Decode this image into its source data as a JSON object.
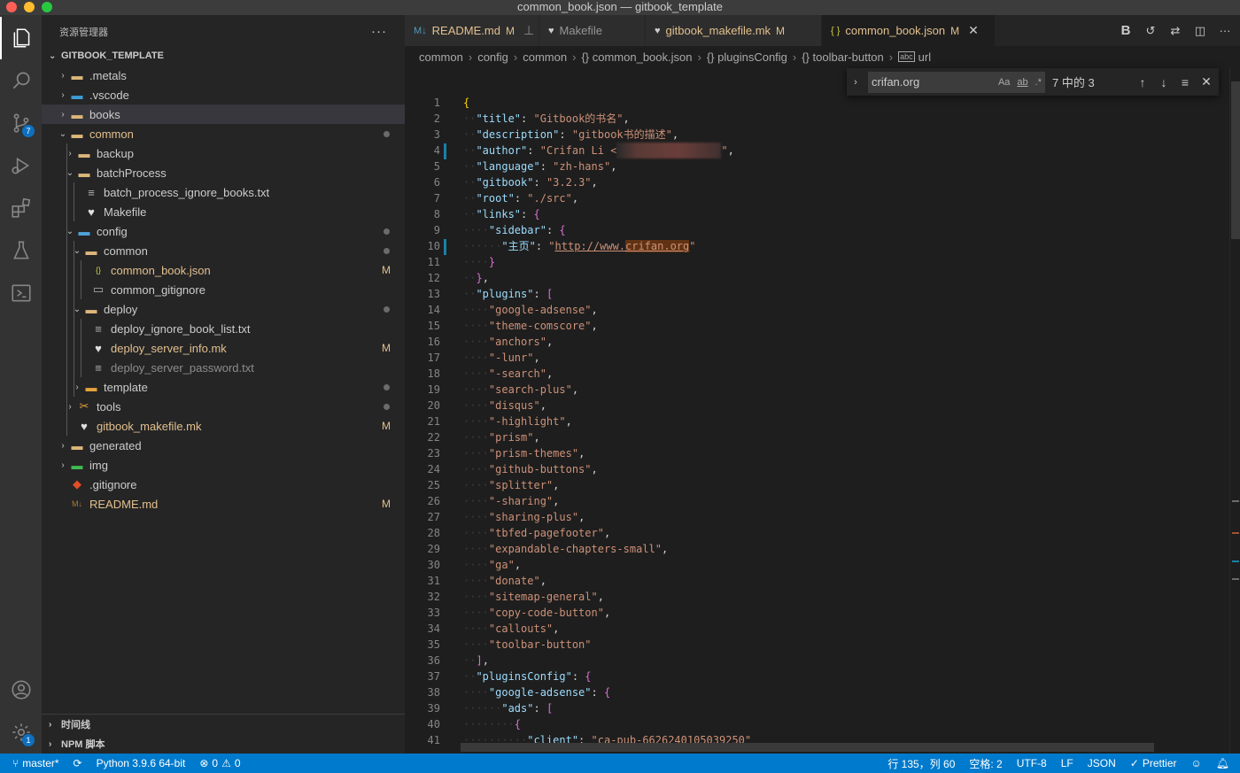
{
  "window": {
    "title": "common_book.json — gitbook_template"
  },
  "activity": {
    "scm_badge": "7",
    "settings_badge": "1"
  },
  "sidebar": {
    "title": "资源管理器",
    "more": "···",
    "root": "GITBOOK_TEMPLATE",
    "tree": [
      {
        "label": ".metals",
        "depth": 0,
        "twist": "›",
        "icon": "folder",
        "state": ""
      },
      {
        "label": ".vscode",
        "depth": 0,
        "twist": "›",
        "icon": "folder-vscode",
        "state": ""
      },
      {
        "label": "books",
        "depth": 0,
        "twist": "›",
        "icon": "folder",
        "state": "",
        "selected": true
      },
      {
        "label": "common",
        "depth": 0,
        "twist": "⌄",
        "icon": "folder-open",
        "state": "dot",
        "color": "mod"
      },
      {
        "label": "backup",
        "depth": 1,
        "twist": "›",
        "icon": "folder",
        "state": ""
      },
      {
        "label": "batchProcess",
        "depth": 1,
        "twist": "⌄",
        "icon": "folder-open",
        "state": ""
      },
      {
        "label": "batch_process_ignore_books.txt",
        "depth": 2,
        "twist": "",
        "icon": "file-text",
        "state": ""
      },
      {
        "label": "Makefile",
        "depth": 2,
        "twist": "",
        "icon": "makefile",
        "state": ""
      },
      {
        "label": "config",
        "depth": 1,
        "twist": "⌄",
        "icon": "folder-config",
        "state": "dot"
      },
      {
        "label": "common",
        "depth": 2,
        "twist": "⌄",
        "icon": "folder-open",
        "state": "dot"
      },
      {
        "label": "common_book.json",
        "depth": 3,
        "twist": "",
        "icon": "json",
        "state": "M",
        "color": "mod"
      },
      {
        "label": "common_gitignore",
        "depth": 3,
        "twist": "",
        "icon": "file",
        "state": ""
      },
      {
        "label": "deploy",
        "depth": 2,
        "twist": "⌄",
        "icon": "folder-open",
        "state": "dot"
      },
      {
        "label": "deploy_ignore_book_list.txt",
        "depth": 3,
        "twist": "",
        "icon": "file-text",
        "state": ""
      },
      {
        "label": "deploy_server_info.mk",
        "depth": 3,
        "twist": "",
        "icon": "makefile",
        "state": "M",
        "color": "mod"
      },
      {
        "label": "deploy_server_password.txt",
        "depth": 3,
        "twist": "",
        "icon": "file-text",
        "state": "",
        "color": "dim"
      },
      {
        "label": "template",
        "depth": 2,
        "twist": "›",
        "icon": "folder-template",
        "state": "dot"
      },
      {
        "label": "tools",
        "depth": 1,
        "twist": "›",
        "icon": "folder-tools",
        "state": "dot"
      },
      {
        "label": "gitbook_makefile.mk",
        "depth": 1,
        "twist": "",
        "icon": "makefile",
        "state": "M",
        "color": "mod"
      },
      {
        "label": "generated",
        "depth": 0,
        "twist": "›",
        "icon": "folder",
        "state": ""
      },
      {
        "label": "img",
        "depth": 0,
        "twist": "›",
        "icon": "folder-img",
        "state": ""
      },
      {
        "label": ".gitignore",
        "depth": 0,
        "twist": "",
        "icon": "git",
        "state": ""
      },
      {
        "label": "README.md",
        "depth": 0,
        "twist": "",
        "icon": "markdown",
        "state": "M",
        "color": "mod"
      }
    ],
    "timeline": "时间线",
    "npm": "NPM 脚本"
  },
  "tabs": [
    {
      "label": "README.md",
      "icon": "markdown",
      "modified": "M",
      "pinned": true,
      "active": false
    },
    {
      "label": "Makefile",
      "icon": "makefile",
      "modified": "",
      "active": false
    },
    {
      "label": "gitbook_makefile.mk",
      "icon": "makefile",
      "modified": "M",
      "active": false
    },
    {
      "label": "common_book.json",
      "icon": "json",
      "modified": "M",
      "active": true
    }
  ],
  "breadcrumb": [
    "common",
    "config",
    "common",
    "{} common_book.json",
    "{} pluginsConfig",
    "{} toolbar-button",
    "url"
  ],
  "find": {
    "query": "crifan.org",
    "count": "7 中的 3",
    "opt_case": "Aa",
    "opt_word": "ab",
    "opt_regex": ".*"
  },
  "code": [
    {
      "n": "1",
      "t": "{"
    },
    {
      "n": "2",
      "t": "\"title\": \"Gitbook的书名\","
    },
    {
      "n": "3",
      "t": "\"description\": \"gitbook书的描述\","
    },
    {
      "n": "4",
      "t": "\"author\": \"Crifan Li <"
    },
    {
      "n": "5",
      "t": "\"language\": \"zh-hans\","
    },
    {
      "n": "6",
      "t": "\"gitbook\": \"3.2.3\","
    },
    {
      "n": "7",
      "t": "\"root\": \"./src\","
    },
    {
      "n": "8",
      "t": "\"links\": {"
    },
    {
      "n": "9",
      "t": "\"sidebar\": {"
    },
    {
      "n": "10",
      "t": "\"主页\": \"http://www.crifan.org\""
    },
    {
      "n": "11",
      "t": "}"
    },
    {
      "n": "12",
      "t": "},"
    },
    {
      "n": "13",
      "t": "\"plugins\": ["
    },
    {
      "n": "14",
      "t": "\"google-adsense\","
    },
    {
      "n": "15",
      "t": "\"theme-comscore\","
    },
    {
      "n": "16",
      "t": "\"anchors\","
    },
    {
      "n": "17",
      "t": "\"-lunr\","
    },
    {
      "n": "18",
      "t": "\"-search\","
    },
    {
      "n": "19",
      "t": "\"search-plus\","
    },
    {
      "n": "20",
      "t": "\"disqus\","
    },
    {
      "n": "21",
      "t": "\"-highlight\","
    },
    {
      "n": "22",
      "t": "\"prism\","
    },
    {
      "n": "23",
      "t": "\"prism-themes\","
    },
    {
      "n": "24",
      "t": "\"github-buttons\","
    },
    {
      "n": "25",
      "t": "\"splitter\","
    },
    {
      "n": "26",
      "t": "\"-sharing\","
    },
    {
      "n": "27",
      "t": "\"sharing-plus\","
    },
    {
      "n": "28",
      "t": "\"tbfed-pagefooter\","
    },
    {
      "n": "29",
      "t": "\"expandable-chapters-small\","
    },
    {
      "n": "30",
      "t": "\"ga\","
    },
    {
      "n": "31",
      "t": "\"donate\","
    },
    {
      "n": "32",
      "t": "\"sitemap-general\","
    },
    {
      "n": "33",
      "t": "\"copy-code-button\","
    },
    {
      "n": "34",
      "t": "\"callouts\","
    },
    {
      "n": "35",
      "t": "\"toolbar-button\""
    },
    {
      "n": "36",
      "t": "],"
    },
    {
      "n": "37",
      "t": "\"pluginsConfig\": {"
    },
    {
      "n": "38",
      "t": "\"google-adsense\": {"
    },
    {
      "n": "39",
      "t": "\"ads\": ["
    },
    {
      "n": "40",
      "t": "{"
    },
    {
      "n": "41",
      "t": "\"client\": \"ca-pub-6626240105039250\""
    }
  ],
  "status": {
    "branch": "master*",
    "python": "Python 3.9.6 64-bit",
    "errors": "0",
    "warnings": "0",
    "position": "行 135，列 60",
    "spaces": "空格: 2",
    "encoding": "UTF-8",
    "eol": "LF",
    "language": "JSON",
    "formatter": "Prettier"
  },
  "colors": {
    "accent": "#007acc",
    "modified": "#e2c08d",
    "string": "#ce9178",
    "key": "#9cdcfe"
  }
}
